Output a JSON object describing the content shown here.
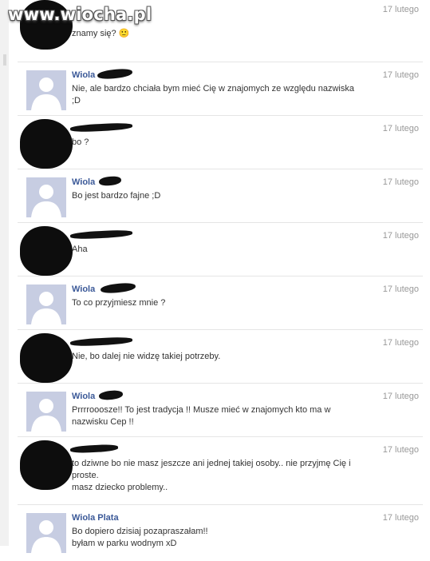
{
  "watermark": "www.wiocha.pl",
  "messages": [
    {
      "sender": "",
      "time": "17 lutego",
      "lines": [
        "znamy się? 🙂"
      ]
    },
    {
      "sender": "Wiola",
      "time": "17 lutego",
      "lines": [
        "Nie, ale bardzo chciała bym mieć Cię w znajomych ze względu nazwiska ;D"
      ]
    },
    {
      "sender": "",
      "time": "17 lutego",
      "lines": [
        "bo ?"
      ]
    },
    {
      "sender": "Wiola",
      "time": "17 lutego",
      "lines": [
        "Bo jest bardzo fajne ;D"
      ]
    },
    {
      "sender": "",
      "time": "17 lutego",
      "lines": [
        "Aha"
      ]
    },
    {
      "sender": "Wiola",
      "time": "17 lutego",
      "lines": [
        "To co przyjmiesz mnie ?"
      ]
    },
    {
      "sender": "",
      "time": "17 lutego",
      "lines": [
        "Nie, bo dalej nie widzę takiej potrzeby."
      ]
    },
    {
      "sender": "Wiola",
      "time": "17 lutego",
      "lines": [
        "Prrrrooosze!! To jest tradycja !! Musze mieć w znajomych kto ma w nazwisku Cep !!"
      ]
    },
    {
      "sender": "",
      "time": "17 lutego",
      "lines": [
        "to dziwne bo nie masz jeszcze ani jednej takiej osoby.. nie przyjmę Cię i proste.",
        "masz dziecko problemy.."
      ]
    },
    {
      "sender": "Wiola Plata",
      "time": "17 lutego",
      "lines": [
        "Bo dopiero dzisiaj pozapraszałam!!",
        "byłam w parku wodnym xD"
      ]
    }
  ]
}
